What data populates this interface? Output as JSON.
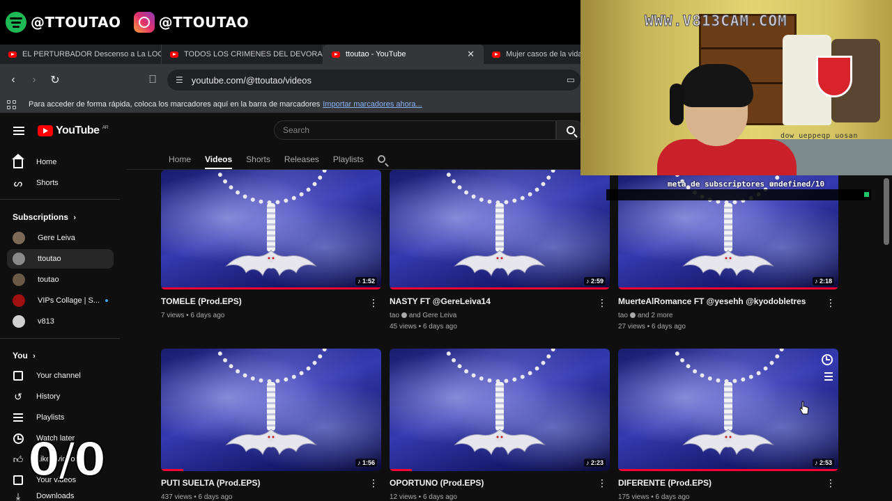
{
  "social": [
    {
      "platform": "spotify",
      "icon": "spotify-icon",
      "handle": "@TTOUTAO"
    },
    {
      "platform": "instagram",
      "icon": "instagram-icon",
      "handle": "@TTOUTAO"
    }
  ],
  "browser": {
    "tabs": [
      {
        "title": "EL PERTURBADOR Descenso a La LOCURA",
        "active": false
      },
      {
        "title": "TODOS LOS CRIMENES DEL DEVORADOR",
        "active": false
      },
      {
        "title": "ttoutao - YouTube",
        "active": true,
        "close": "✕"
      },
      {
        "title": "Mujer casos de la vida real",
        "active": false
      }
    ],
    "url": "youtube.com/@ttoutao/videos",
    "bookmarks_text": "Para acceder de forma rápida, coloca los marcadores aquí en la barra de marcadores",
    "bookmarks_link": "Importar marcadores ahora..."
  },
  "youtube": {
    "logo_text": "YouTube",
    "country": "AR",
    "search_placeholder": "Search",
    "channel_tabs": [
      "Home",
      "Videos",
      "Shorts",
      "Releases",
      "Playlists"
    ],
    "active_tab": "Videos"
  },
  "sidebar": {
    "main": [
      {
        "label": "Home",
        "icon": "home-icon"
      },
      {
        "label": "Shorts",
        "icon": "shorts-icon"
      }
    ],
    "subscriptions_header": "Subscriptions",
    "subscriptions": [
      {
        "label": "Gere Leiva",
        "avatar_color": "#7d6a55"
      },
      {
        "label": "ttoutao",
        "avatar_color": "#8a8a8a",
        "active": true
      },
      {
        "label": "toutao",
        "avatar_color": "#6b5a45"
      },
      {
        "label": "VIPs Collage | S...",
        "avatar_color": "#a01010",
        "live": true
      },
      {
        "label": "v813",
        "avatar_color": "#d0d0d0"
      }
    ],
    "you_header": "You",
    "you": [
      {
        "label": "Your channel",
        "icon": "channel-icon"
      },
      {
        "label": "History",
        "icon": "history-icon"
      },
      {
        "label": "Playlists",
        "icon": "playlists-icon"
      },
      {
        "label": "Watch later",
        "icon": "watch-later-icon"
      },
      {
        "label": "Liked videos",
        "icon": "like-icon"
      },
      {
        "label": "Your videos",
        "icon": "your-videos-icon"
      },
      {
        "label": "Downloads",
        "icon": "download-icon"
      }
    ]
  },
  "videos": [
    {
      "title": "TOMELE (Prod.EPS)",
      "duration": "1:52",
      "meta1": "7 views • 6 days ago",
      "meta2": "",
      "progress": 1.0
    },
    {
      "title": "NASTY FT @GereLeiva14",
      "duration": "2:59",
      "meta1": "tao",
      "meta1b": "and Gere Leiva",
      "meta2": "45 views • 6 days ago",
      "progress": 1.0
    },
    {
      "title": "MuerteAlRomance FT @yesehh @kyodobletres",
      "duration": "2:18",
      "meta1": "tao",
      "meta1b": "and 2 more",
      "meta2": "27 views • 6 days ago",
      "progress": 1.0
    },
    {
      "title": "PUTI SUELTA (Prod.EPS)",
      "duration": "1:56",
      "meta1": "437 views • 6 days ago",
      "meta2": "",
      "progress": 0.1
    },
    {
      "title": "OPORTUNO (Prod.EPS)",
      "duration": "2:23",
      "meta1": "12 views • 6 days ago",
      "meta2": "",
      "progress": 0.1
    },
    {
      "title": "DIFERENTE (Prod.EPS)",
      "duration": "2:53",
      "meta1": "175 views • 6 days ago",
      "meta2": "",
      "progress": 1.0
    }
  ],
  "overlay": {
    "cam_title": "WWW.V813CAM.COM",
    "cam_small": "dow ueppeqp uosan",
    "goal_text": "meta de subscriptores undefined/10",
    "counter": "0/0"
  },
  "colors": {
    "accent": "#ff0000",
    "progress": "#ff0033",
    "goal_end": "#21c46b"
  }
}
